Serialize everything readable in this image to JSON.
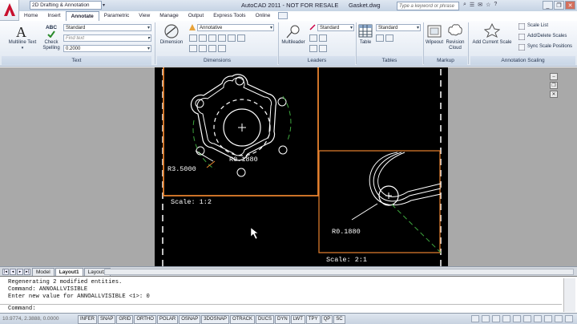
{
  "window": {
    "app_title": "AutoCAD 2011 - NOT FOR RESALE",
    "file_name": "Gasket.dwg",
    "workspace": "2D Drafting & Annotation",
    "search_placeholder": "Type a keyword or phrase"
  },
  "ribbon_tabs": [
    "Home",
    "Insert",
    "Annotate",
    "Parametric",
    "View",
    "Manage",
    "Output",
    "Express Tools",
    "Online"
  ],
  "active_tab": "Annotate",
  "ribbon": {
    "text": {
      "panel": "Text",
      "multiline_text": "Multiline Text",
      "check_spelling": "Check Spelling",
      "abc": "ABC",
      "style": "Standard",
      "find_placeholder": "Find text",
      "height": "0.2000"
    },
    "dimensions": {
      "panel": "Dimensions",
      "dimension": "Dimension",
      "style": "Annotative"
    },
    "leaders": {
      "panel": "Leaders",
      "multileader": "Multileader",
      "style": "Standard"
    },
    "tables": {
      "panel": "Tables",
      "table": "Table",
      "style": "Standard"
    },
    "markup": {
      "panel": "Markup",
      "wipeout": "Wipeout",
      "revision_cloud": "Revision Cloud"
    },
    "annotation_scaling": {
      "panel": "Annotation Scaling",
      "add_current_scale": "Add Current Scale",
      "scale_list": "Scale List",
      "add_delete_scales": "Add/Delete Scales",
      "sync_scale_positions": "Sync Scale Positions"
    }
  },
  "drawing": {
    "viewport1_label": "R3.5000",
    "viewport1_radius": "R0.1880",
    "viewport1_scale": "Scale: 1:2",
    "viewport2_radius": "R0.1880",
    "viewport2_scale": "Scale: 2:1",
    "accent_color": "#e8822e"
  },
  "layout_tabs": [
    "Model",
    "Layout1",
    "Layout2"
  ],
  "active_layout": "Layout1",
  "command_history": [
    "Regenerating 2 modified entities.",
    "Command: ANNOALLVISIBLE",
    "Enter new value for ANNOALLVISIBLE <1>: 0"
  ],
  "command_prompt": "Command:",
  "status": {
    "coordinates": "10.9774, 2.3888, 0.0000",
    "toggles": [
      "INFER",
      "SNAP",
      "GRID",
      "ORTHO",
      "POLAR",
      "OSNAP",
      "3DOSNAP",
      "OTRACK",
      "DUCS",
      "DYN",
      "LWT",
      "TPY",
      "QP",
      "SC"
    ]
  }
}
